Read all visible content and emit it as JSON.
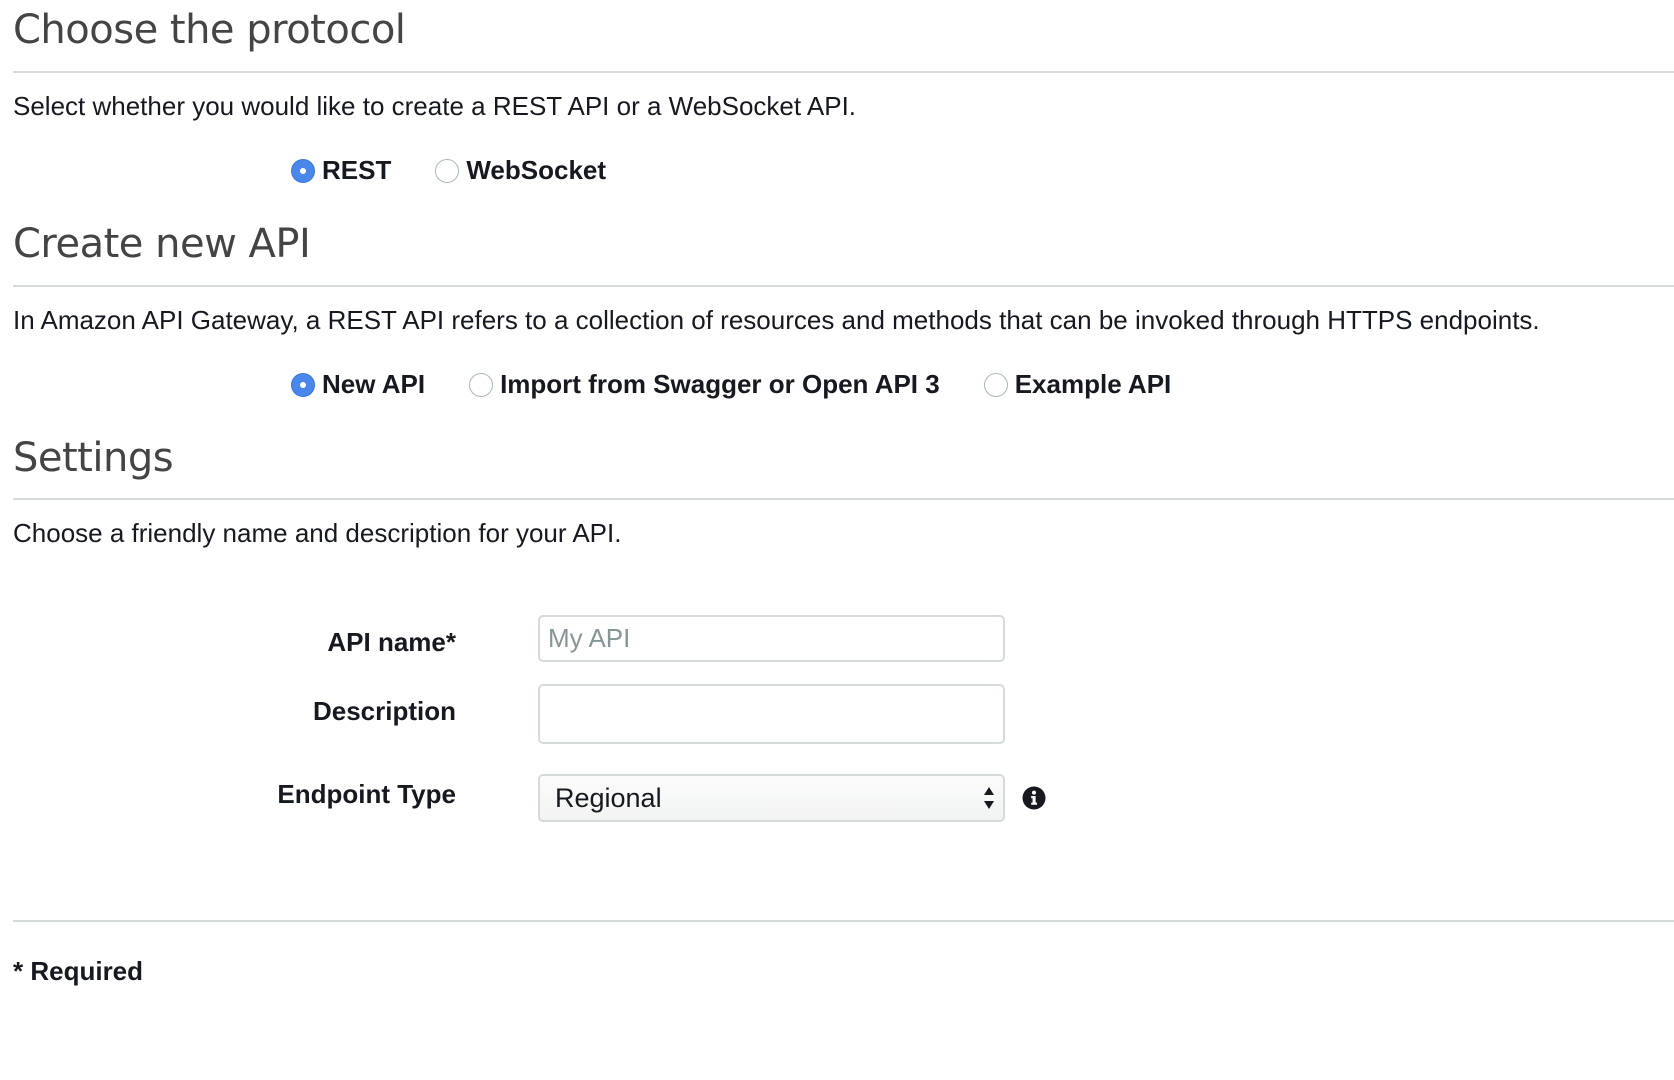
{
  "protocol_section": {
    "title": "Choose the protocol",
    "description": "Select whether you would like to create a REST API or a WebSocket API.",
    "options": [
      {
        "label": "REST",
        "checked": true
      },
      {
        "label": "WebSocket",
        "checked": false
      }
    ]
  },
  "create_section": {
    "title": "Create new API",
    "description": "In Amazon API Gateway, a REST API refers to a collection of resources and methods that can be invoked through HTTPS endpoints.",
    "options": [
      {
        "label": "New API",
        "checked": true
      },
      {
        "label": "Import from Swagger or Open API 3",
        "checked": false
      },
      {
        "label": "Example API",
        "checked": false
      }
    ]
  },
  "settings_section": {
    "title": "Settings",
    "description": "Choose a friendly name and description for your API.",
    "api_name": {
      "label": "API name*",
      "value": "",
      "placeholder": "My API"
    },
    "description_field": {
      "label": "Description",
      "value": ""
    },
    "endpoint_type": {
      "label": "Endpoint Type",
      "selected": "Regional"
    }
  },
  "footer": {
    "required_note": "* Required"
  },
  "colors": {
    "radio_checked": "#4a87ea",
    "rule": "#d5dbdb",
    "heading": "#444444"
  },
  "icons": {
    "info": "info-circle-icon",
    "select_arrows": "select-updown-arrows-icon"
  }
}
